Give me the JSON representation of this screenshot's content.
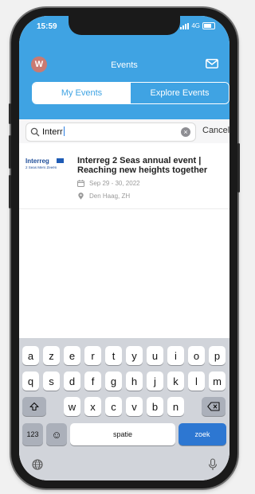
{
  "status_bar": {
    "time": "15:59",
    "network": "4G"
  },
  "header": {
    "avatar_initial": "W",
    "title": "Events",
    "mail_icon": "mail-icon",
    "tabs": [
      {
        "label": "My Events",
        "active": false
      },
      {
        "label": "Explore Events",
        "active": true
      }
    ],
    "color": "#3fa3e3"
  },
  "search": {
    "value": "Interr",
    "cancel_label": "Cancel",
    "icon": "search-icon",
    "clear_icon": "clear-icon"
  },
  "events": [
    {
      "logo_text": "Interreg",
      "logo_subtext": "2 Seas Mers Zeeën",
      "title": "Interreg 2 Seas annual event | Reaching new heights together",
      "date": "Sep 29 - 30, 2022",
      "location": "Den Haag, ZH"
    }
  ],
  "keyboard": {
    "rows": [
      [
        "a",
        "z",
        "e",
        "r",
        "t",
        "y",
        "u",
        "i",
        "o",
        "p"
      ],
      [
        "q",
        "s",
        "d",
        "f",
        "g",
        "h",
        "j",
        "k",
        "l",
        "m"
      ],
      [
        "w",
        "x",
        "c",
        "v",
        "b",
        "n"
      ]
    ],
    "numbers_label": "123",
    "emoji_label": "☺",
    "space_label": "spatie",
    "return_label": "zoek",
    "icons": [
      "shift-icon",
      "backspace-icon",
      "globe-icon",
      "microphone-icon"
    ]
  }
}
